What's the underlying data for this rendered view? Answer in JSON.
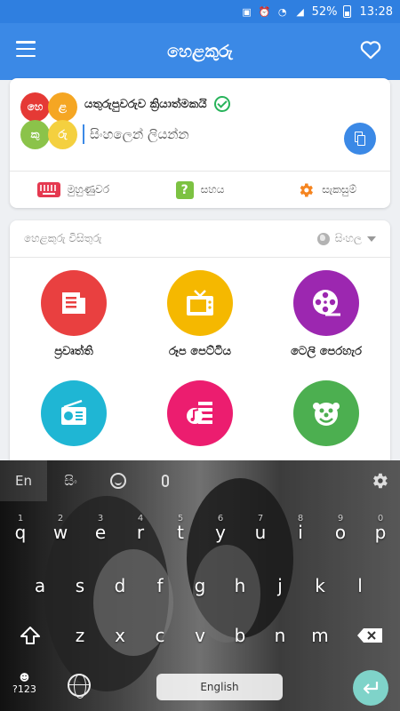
{
  "status_bar": {
    "battery": "52%",
    "time": "13:28"
  },
  "app": {
    "title": "හෙළකුරු"
  },
  "input_card": {
    "logo_letters": [
      "හෙ",
      "ළ",
      "කු",
      "රු"
    ],
    "logo_colors": [
      "#e53935",
      "#f5a623",
      "#8bc34a",
      "#f4d03f"
    ],
    "enabled_text": "යතුරුපුවරුව ක්‍රියාත්මකයි",
    "placeholder": "සිංහලෙන් ලියන්න",
    "tools": [
      {
        "label": "මුහුණුවර",
        "icon": "keyboard-icon"
      },
      {
        "label": "සහය",
        "icon": "help-icon"
      },
      {
        "label": "සැකසුම්",
        "icon": "gear-icon"
      }
    ]
  },
  "services": {
    "heading": "හෙළකුරු විසිතුරු",
    "language": "සිංහල",
    "items": [
      {
        "label": "ප්‍රවෘත්ති",
        "icon": "news-icon",
        "color": "#e94040"
      },
      {
        "label": "රූප පෙට්ටිය",
        "icon": "tv-icon",
        "color": "#f5b800"
      },
      {
        "label": "ටෙලි පෙරහැර",
        "icon": "film-reel-icon",
        "color": "#9c27b0"
      },
      {
        "label": "",
        "icon": "radio-icon",
        "color": "#1fb6d4"
      },
      {
        "label": "",
        "icon": "music-list-icon",
        "color": "#ec1d6f"
      },
      {
        "label": "",
        "icon": "clown-icon",
        "color": "#4caf50"
      }
    ]
  },
  "keyboard": {
    "toolbar": {
      "lang_en": "En",
      "lang_si": "සිං"
    },
    "row1": [
      {
        "k": "q",
        "n": "1"
      },
      {
        "k": "w",
        "n": "2"
      },
      {
        "k": "e",
        "n": "3"
      },
      {
        "k": "r",
        "n": "4"
      },
      {
        "k": "t",
        "n": "5"
      },
      {
        "k": "y",
        "n": "6"
      },
      {
        "k": "u",
        "n": "7"
      },
      {
        "k": "i",
        "n": "8"
      },
      {
        "k": "o",
        "n": "9"
      },
      {
        "k": "p",
        "n": "0"
      }
    ],
    "row2": [
      "a",
      "s",
      "d",
      "f",
      "g",
      "h",
      "j",
      "k",
      "l"
    ],
    "row3": [
      "z",
      "x",
      "c",
      "v",
      "b",
      "n",
      "m"
    ],
    "symbols_label": "?123",
    "space_label": "English"
  }
}
